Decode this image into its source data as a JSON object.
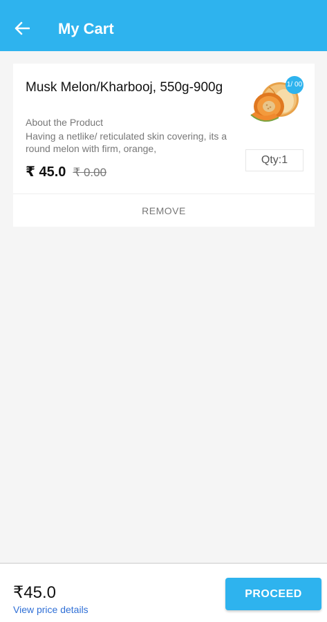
{
  "header": {
    "title": "My Cart",
    "back_icon": "arrow-left-icon"
  },
  "cart_item": {
    "name": "Musk Melon/Kharbooj, 550g-900g",
    "about_label": "About the Product",
    "about_text": "Having a netlike/ reticulated skin covering, its a round melon with firm, orange,",
    "price": "₹ 45.0",
    "mrp": "₹ 0.00",
    "count_badge": "1/ 00",
    "quantity": "Qty:1",
    "remove_label": "REMOVE",
    "image_icon": "musk-melon-image"
  },
  "footer": {
    "total": "₹45.0",
    "price_details_link": "View price details",
    "proceed_label": "PROCEED"
  },
  "colors": {
    "accent": "#2eb3ee",
    "link": "#2f6fd6"
  }
}
